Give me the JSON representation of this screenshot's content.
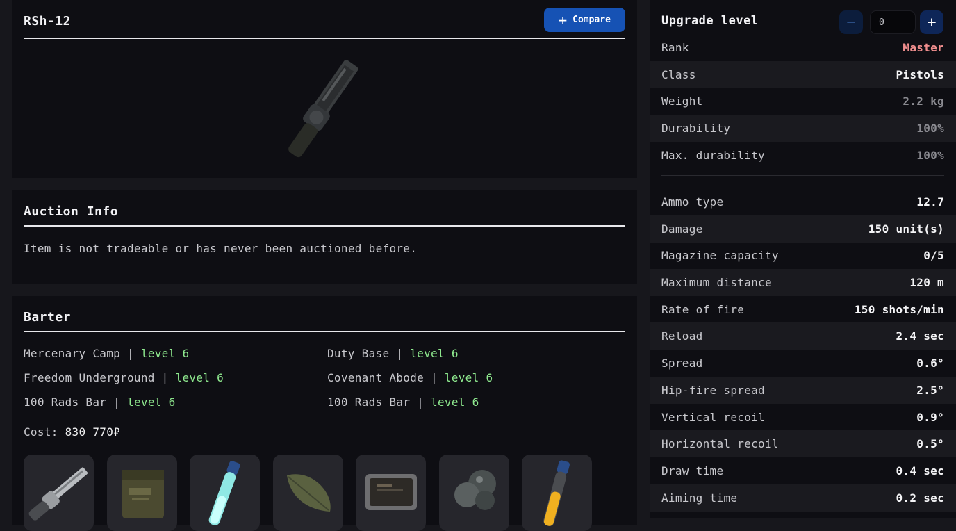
{
  "item": {
    "name": "RSh-12",
    "compare_label": "Compare"
  },
  "auction": {
    "title": "Auction Info",
    "message": "Item is not tradeable or has never been auctioned before."
  },
  "barter": {
    "title": "Barter",
    "traders": [
      {
        "name": "Mercenary Camp",
        "sep": " | ",
        "level": "level 6"
      },
      {
        "name": "Duty Base",
        "sep": " | ",
        "level": "level 6"
      },
      {
        "name": "Freedom Underground",
        "sep": " | ",
        "level": "level 6"
      },
      {
        "name": "Covenant Abode",
        "sep": " | ",
        "level": "level 6"
      },
      {
        "name": "100 Rads Bar",
        "sep": " | ",
        "level": "level 6"
      },
      {
        "name": "100 Rads Bar",
        "sep": " | ",
        "level": "level 6"
      }
    ],
    "cost_label": "Cost:",
    "cost_value": "830 770₽",
    "items": [
      "revolver-icon",
      "ammo-box-icon",
      "blue-vial-icon",
      "leaf-icon",
      "tablet-icon",
      "mushroom-icon",
      "orange-vial-icon"
    ]
  },
  "upgrade": {
    "label": "Upgrade level",
    "minus": "−",
    "plus": "+",
    "value": "0"
  },
  "stats": [
    {
      "key": "Rank",
      "value": "Master"
    },
    {
      "key": "Class",
      "value": "Pistols"
    },
    {
      "key": "Weight",
      "value": "2.2 kg"
    },
    {
      "key": "Durability",
      "value": "100%"
    },
    {
      "key": "Max. durability",
      "value": "100%"
    },
    {
      "key": "Ammo type",
      "value": "12.7"
    },
    {
      "key": "Damage",
      "value": "150 unit(s)"
    },
    {
      "key": "Magazine capacity",
      "value": "0/5"
    },
    {
      "key": "Maximum distance",
      "value": "120 m"
    },
    {
      "key": "Rate of fire",
      "value": "150 shots/min"
    },
    {
      "key": "Reload",
      "value": "2.4 sec"
    },
    {
      "key": "Spread",
      "value": "0.6°"
    },
    {
      "key": "Hip-fire spread",
      "value": "2.5°"
    },
    {
      "key": "Vertical recoil",
      "value": "0.9°"
    },
    {
      "key": "Horizontal recoil",
      "value": "0.5°"
    },
    {
      "key": "Draw time",
      "value": "0.4 sec"
    },
    {
      "key": "Aiming time",
      "value": "0.2 sec"
    }
  ],
  "colors": {
    "accent": "#1652b4",
    "rank": "#ee8d8d",
    "level": "#8ee88e"
  }
}
